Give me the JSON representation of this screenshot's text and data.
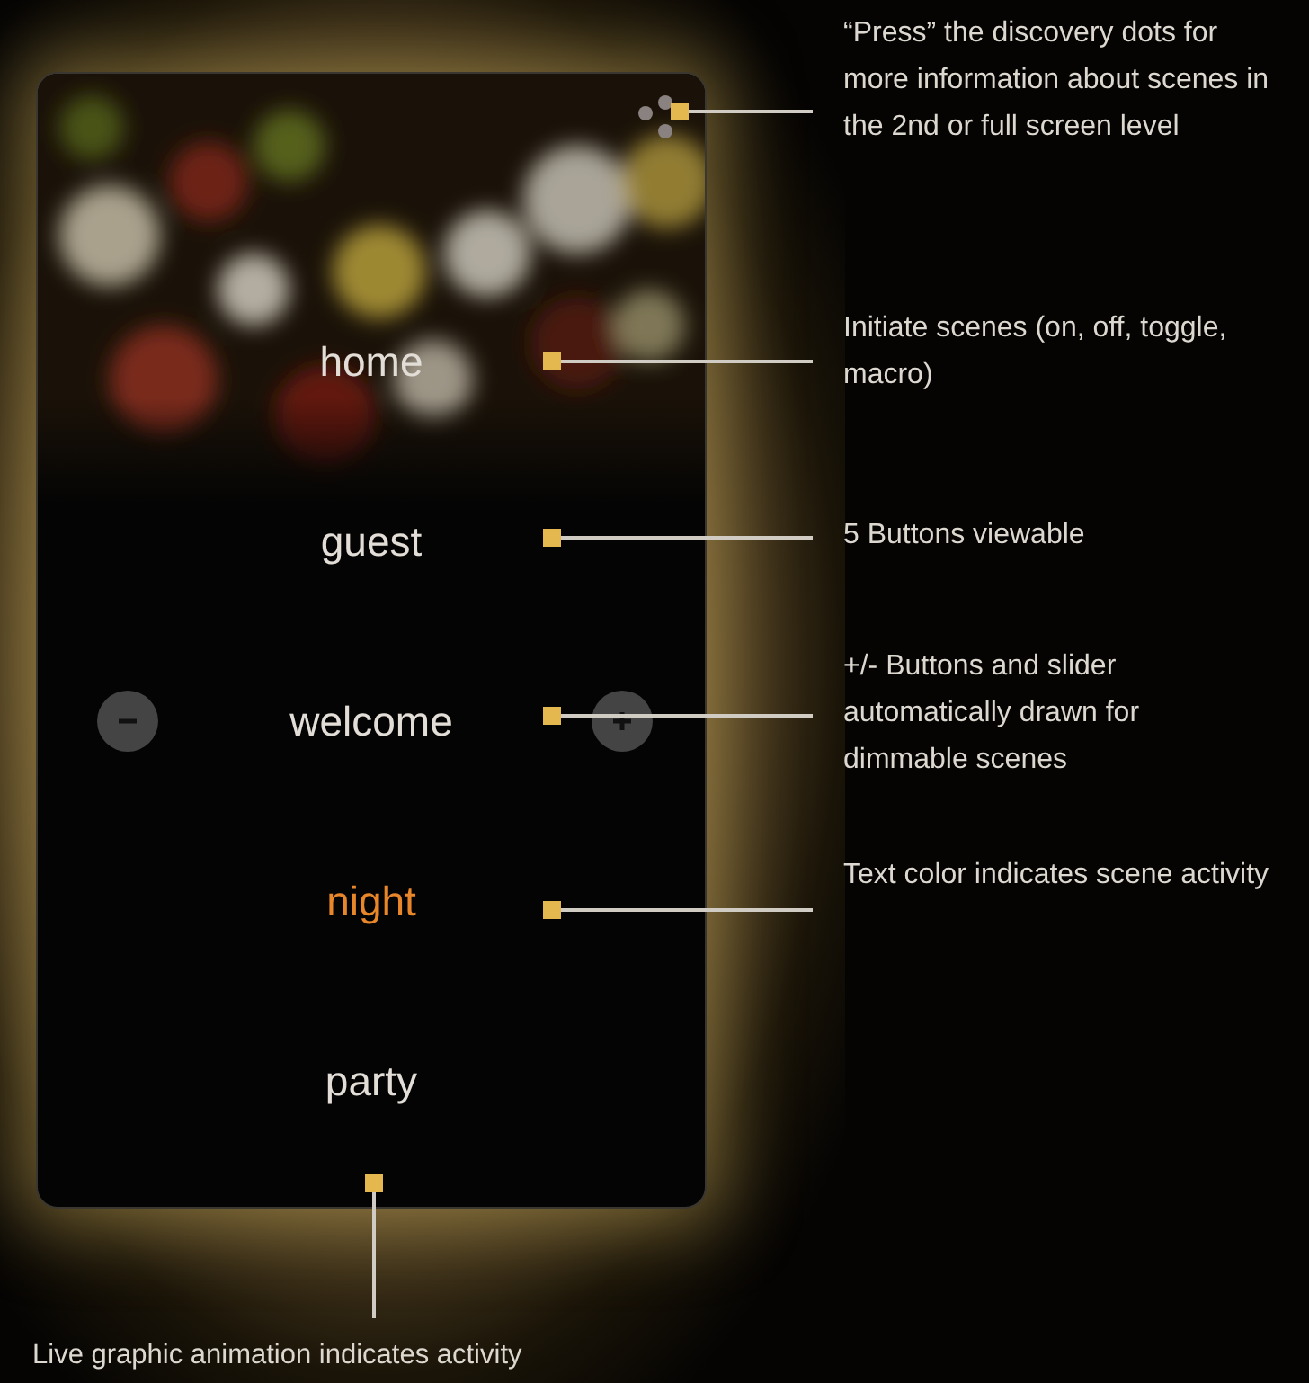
{
  "scenes": [
    {
      "label": "home",
      "active": false,
      "dimmable": false
    },
    {
      "label": "guest",
      "active": false,
      "dimmable": false
    },
    {
      "label": "welcome",
      "active": false,
      "dimmable": true
    },
    {
      "label": "night",
      "active": true,
      "dimmable": false
    },
    {
      "label": "party",
      "active": false,
      "dimmable": false
    }
  ],
  "annotations": [
    {
      "text": "“Press” the discovery dots for more information about scenes in the 2nd or full screen level"
    },
    {
      "text": "Initiate scenes (on, off, toggle, macro)"
    },
    {
      "text": "5 Buttons viewable"
    },
    {
      "text": "+/- Buttons and slider automatically drawn for dimmable scenes"
    },
    {
      "text": "Text color indicates scene activity"
    }
  ],
  "caption": "Live graphic animation indicates activity"
}
